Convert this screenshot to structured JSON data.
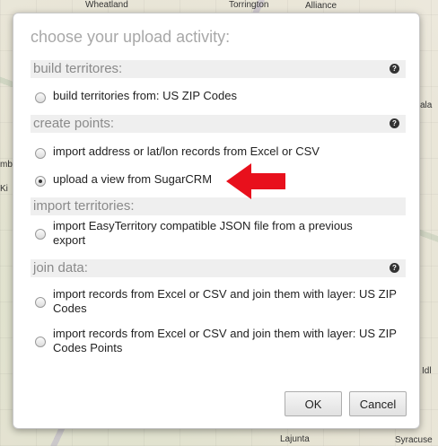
{
  "map": {
    "labels": [
      "Wheatland",
      "Torrington",
      "Alliance",
      "Lajunta",
      "Syracuse",
      "mb",
      "Ki",
      "ala",
      "Idl"
    ]
  },
  "dialog": {
    "title": "choose your upload activity:",
    "sections": [
      {
        "header": "build territores:",
        "has_help": true,
        "options": [
          {
            "label": "build territories from: US ZIP Codes",
            "checked": false
          }
        ]
      },
      {
        "header": "create points:",
        "has_help": true,
        "options": [
          {
            "label": "import address or lat/lon records from Excel or CSV",
            "checked": false
          },
          {
            "label": "upload a view from SugarCRM",
            "checked": true
          }
        ]
      },
      {
        "header": "import territories:",
        "has_help": false,
        "options": [
          {
            "label": "import EasyTerritory compatible JSON file from a previous export",
            "checked": false
          }
        ]
      },
      {
        "header": "join data:",
        "has_help": true,
        "options": [
          {
            "label": "import records from Excel or CSV and join them with layer: US ZIP Codes",
            "checked": false
          },
          {
            "label": "import records from Excel or CSV and join them with layer: US ZIP Codes Points",
            "checked": false
          }
        ]
      }
    ],
    "help_icon_text": "?",
    "ok_label": "OK",
    "cancel_label": "Cancel"
  },
  "colors": {
    "arrow": "#e8101c",
    "section_bg": "#efefef",
    "title": "#a8a8a8"
  }
}
